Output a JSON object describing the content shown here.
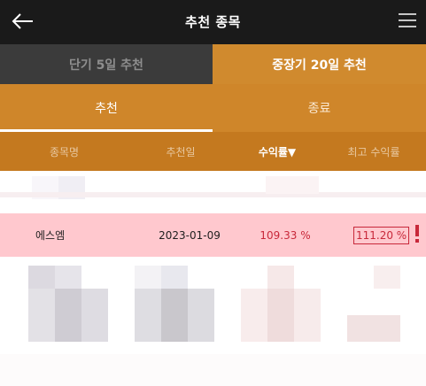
{
  "header": {
    "title": "추천 종목",
    "back_icon": "arrow-left-icon",
    "menu_icon": "hamburger-menu-icon"
  },
  "period_tabs": [
    {
      "label": "단기 5일 추천",
      "active": false
    },
    {
      "label": "중장기 20일 추천",
      "active": true
    }
  ],
  "sub_tabs": [
    {
      "label": "추천",
      "active": true
    },
    {
      "label": "종료",
      "active": false
    }
  ],
  "columns": {
    "name": "종목명",
    "date": "추천일",
    "return": "수익률▼",
    "max_return": "최고 수익률"
  },
  "rows": [
    {
      "name": "에스엠",
      "date": "2023-01-09",
      "return": "109.33 %",
      "max_return": "111.20 %"
    }
  ],
  "colors": {
    "topbar": "#1a1a1a",
    "accent": "#cf862a",
    "header_row": "#c4791f",
    "highlight_row": "#ffc8ce",
    "return_red": "#c8283a"
  }
}
